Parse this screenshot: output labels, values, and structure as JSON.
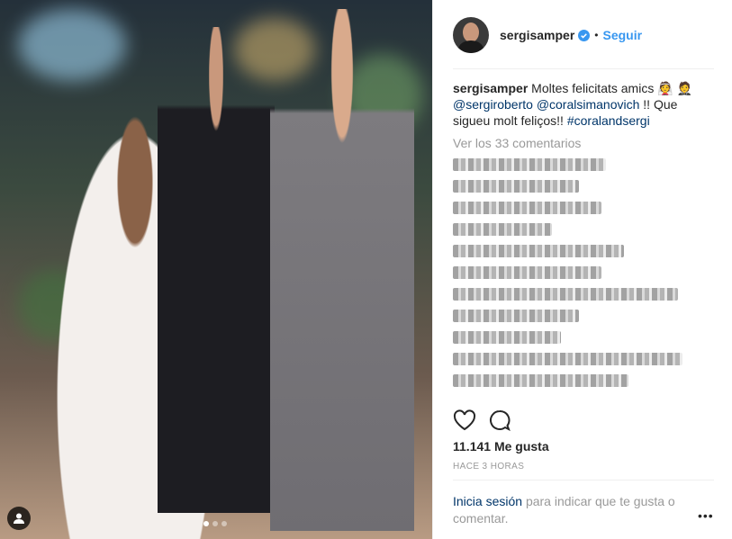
{
  "post": {
    "username": "sergisamper",
    "follow_label": "Seguir",
    "separator": "•",
    "caption": {
      "username": "sergisamper",
      "text1": "Moltes felicitats amics 👰 🤵",
      "mention1": "@sergiroberto",
      "mention2": "@coralsimanovich",
      "text2": "!! Que sigueu molt feliços!!",
      "hashtag": "#coralandsergi"
    },
    "view_comments": "Ver los 33 comentarios",
    "likes": "11.141 Me gusta",
    "time": "HACE 3 HORAS",
    "login_link": "Inicia sesión",
    "login_text": "para indicar que te gusta o comentar.",
    "more": "•••"
  },
  "carousel": {
    "count": 3,
    "active_index": 0
  },
  "colors": {
    "link": "#003569",
    "accent": "#3897f0",
    "muted": "#999999"
  },
  "icons": [
    "verified-badge-icon",
    "heart-icon",
    "comment-icon",
    "user-tag-icon",
    "more-options-icon"
  ]
}
